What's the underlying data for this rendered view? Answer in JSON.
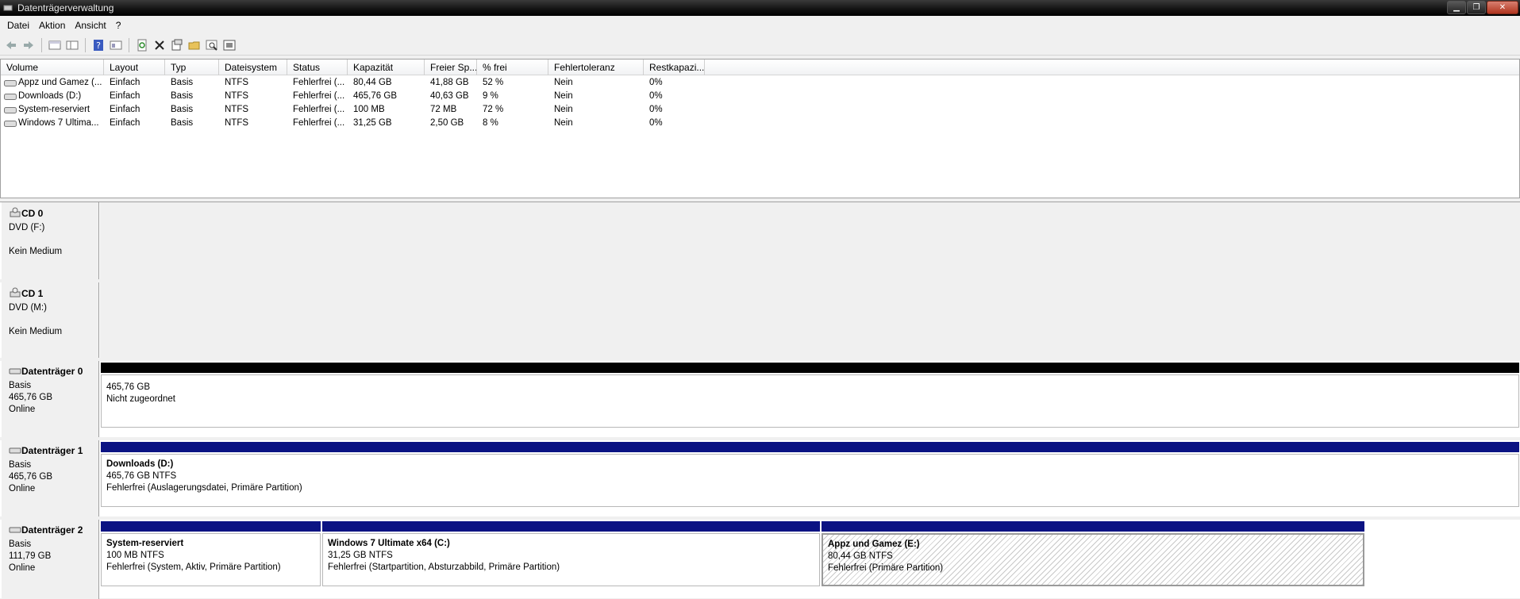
{
  "window": {
    "title": "Datenträgerverwaltung"
  },
  "menu": [
    "Datei",
    "Aktion",
    "Ansicht",
    "?"
  ],
  "toolbar_icons": [
    "back-icon",
    "forward-icon",
    "view-icon",
    "view-detail-icon",
    "help-icon",
    "properties-icon",
    "refresh-icon",
    "delete-icon",
    "properties-sheet-icon",
    "open-icon",
    "explore-icon",
    "rescan-icon"
  ],
  "volume_list": {
    "columns": [
      "Volume",
      "Layout",
      "Typ",
      "Dateisystem",
      "Status",
      "Kapazität",
      "Freier Sp...",
      "% frei",
      "Fehlertoleranz",
      "Restkapazi..."
    ],
    "rows": [
      [
        "Appz und Gamez (...",
        "Einfach",
        "Basis",
        "NTFS",
        "Fehlerfrei (...",
        "80,44 GB",
        "41,88 GB",
        "52 %",
        "Nein",
        "0%"
      ],
      [
        "Downloads (D:)",
        "Einfach",
        "Basis",
        "NTFS",
        "Fehlerfrei (...",
        "465,76 GB",
        "40,63 GB",
        "9 %",
        "Nein",
        "0%"
      ],
      [
        "System-reserviert",
        "Einfach",
        "Basis",
        "NTFS",
        "Fehlerfrei (...",
        "100 MB",
        "72 MB",
        "72 %",
        "Nein",
        "0%"
      ],
      [
        "Windows 7 Ultima...",
        "Einfach",
        "Basis",
        "NTFS",
        "Fehlerfrei (...",
        "31,25 GB",
        "2,50 GB",
        "8 %",
        "Nein",
        "0%"
      ]
    ]
  },
  "disks": {
    "cd0": {
      "name": "CD 0",
      "lines": [
        "DVD (F:)",
        "",
        "Kein Medium"
      ]
    },
    "cd1": {
      "name": "CD 1",
      "lines": [
        "DVD (M:)",
        "",
        "Kein Medium"
      ]
    },
    "disk0": {
      "name": "Datenträger 0",
      "lines": [
        "Basis",
        "465,76 GB",
        "Online"
      ],
      "partitions": [
        {
          "size": "465,76 GB",
          "status": "Nicht zugeordnet"
        }
      ]
    },
    "disk1": {
      "name": "Datenträger 1",
      "lines": [
        "Basis",
        "465,76 GB",
        "Online"
      ],
      "partitions": [
        {
          "name": "Downloads  (D:)",
          "size": "465,76 GB NTFS",
          "status": "Fehlerfrei (Auslagerungsdatei, Primäre Partition)"
        }
      ]
    },
    "disk2": {
      "name": "Datenträger 2",
      "lines": [
        "Basis",
        "111,79 GB",
        "Online"
      ],
      "partitions": [
        {
          "name": "System-reserviert",
          "size": "100 MB NTFS",
          "status": "Fehlerfrei (System, Aktiv, Primäre Partition)"
        },
        {
          "name": "Windows 7 Ultimate x64  (C:)",
          "size": "31,25 GB NTFS",
          "status": "Fehlerfrei (Startpartition, Absturzabbild, Primäre Partition)"
        },
        {
          "name": "Appz und Gamez  (E:)",
          "size": "80,44 GB NTFS",
          "status": "Fehlerfrei (Primäre Partition)"
        }
      ]
    }
  },
  "colors": {
    "unallocated_bar": "#000000",
    "primary_bar": "#0b1383"
  }
}
